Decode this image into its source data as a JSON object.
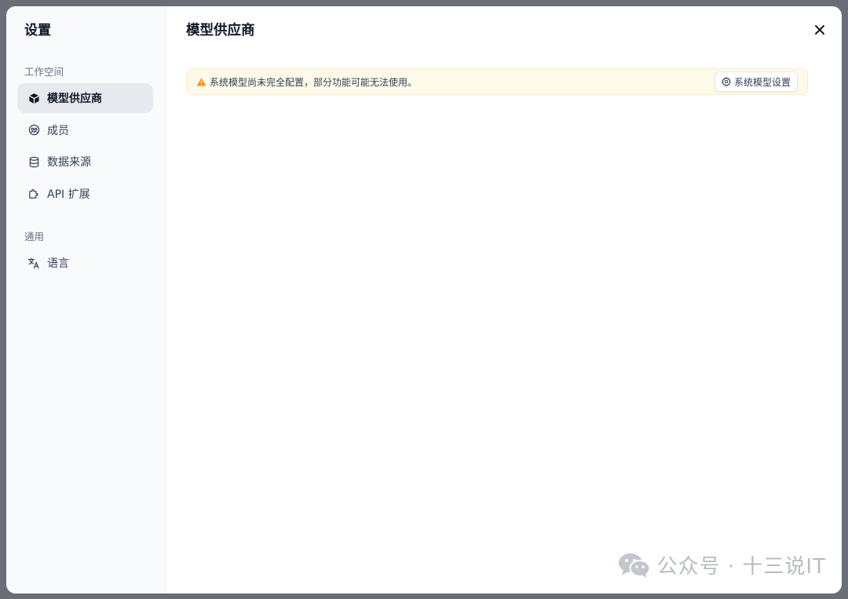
{
  "sidebar": {
    "title": "设置",
    "groups": [
      {
        "label": "工作空间",
        "items": [
          {
            "label": "模型供应商",
            "icon": "cube-icon",
            "active": true
          },
          {
            "label": "成员",
            "icon": "members-icon",
            "active": false
          },
          {
            "label": "数据来源",
            "icon": "database-icon",
            "active": false
          },
          {
            "label": "API 扩展",
            "icon": "puzzle-icon",
            "active": false
          }
        ]
      },
      {
        "label": "通用",
        "items": [
          {
            "label": "语言",
            "icon": "translate-icon",
            "active": false
          }
        ]
      }
    ]
  },
  "main": {
    "title": "模型供应商",
    "close_icon": "close-icon",
    "alert": {
      "icon": "warning-icon",
      "text": "系统模型尚未完全配置，部分功能可能无法使用。",
      "button_label": "系统模型设置",
      "button_icon": "gear-icon"
    }
  },
  "watermark": {
    "text": "公众号 · 十三说IT",
    "icon": "wechat-icon"
  },
  "colors": {
    "overlay": "#6b6e76",
    "active_item_bg": "#e8e9ee",
    "alert_bg": "#fefaea",
    "warning": "#f79009"
  }
}
